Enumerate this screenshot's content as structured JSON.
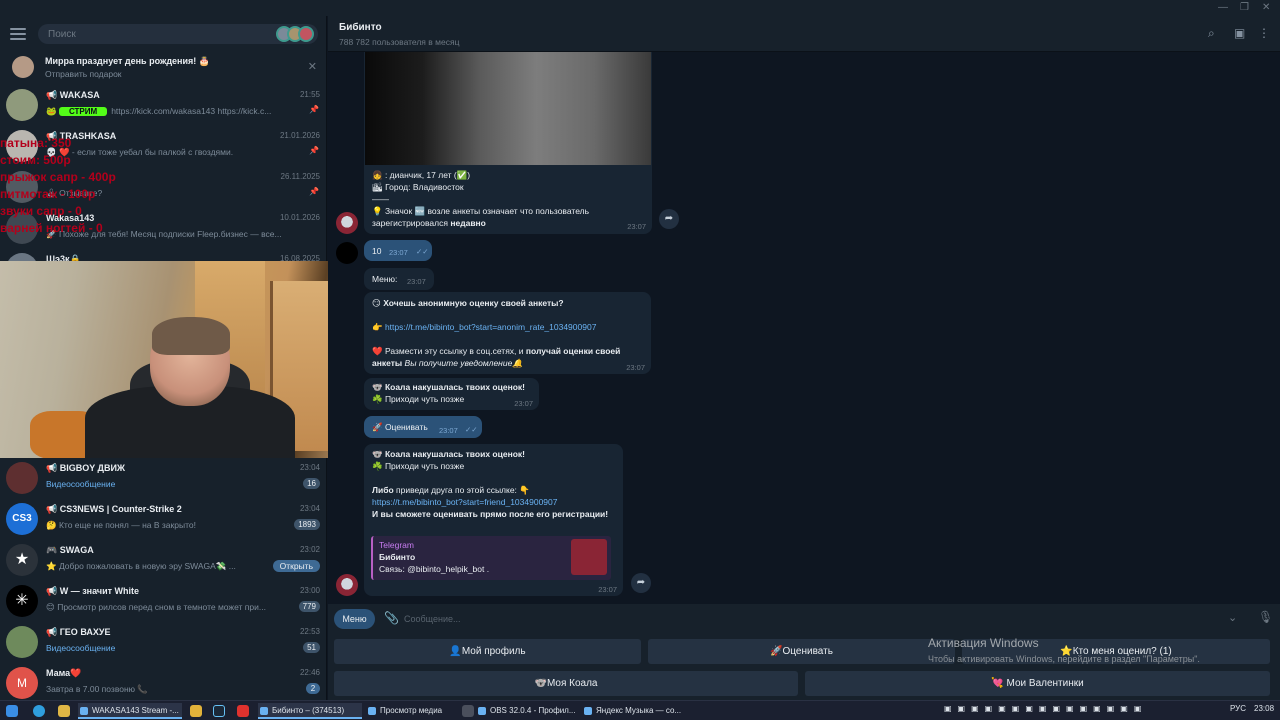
{
  "sidebar": {
    "search_placeholder": "Поиск",
    "birthday": {
      "title": "Мирра празднует день рождения! 🎂",
      "subtitle": "Отправить подарок"
    },
    "chats": [
      {
        "name": "📢 WAKASA",
        "time": "21:55",
        "prefix": "🐸",
        "tag": "СТРИМ",
        "preview": "https://kick.com/wakasa143  https://kick.c..."
      },
      {
        "name": "📢 TRASHKASA",
        "time": "21.01.2026",
        "preview": "💀 ❤️ - если тоже уебал бы палкой с гвоздями."
      },
      {
        "name": "",
        "time": "26.11.2025",
        "preview": "🕹 Отзывите?"
      },
      {
        "name": "Wakasa143",
        "time": "10.01.2026",
        "preview": "🚀 Похоже для тебя! Месяц подписки Fleep.бизнес — все..."
      },
      {
        "name": "Шэ3к🔒",
        "time": "16.08.2025",
        "preview": ""
      },
      {
        "name": "📢 BIGBOY ДВИЖ",
        "time": "23:04",
        "preview": "Видеосообщение",
        "badge": "16"
      },
      {
        "name": "📢 CS3NEWS | Counter-Strike 2",
        "time": "23:04",
        "preview": "🤔 Кто еще не понял — на В закрыто!",
        "badge": "1893"
      },
      {
        "name": "🎮 SWAGA",
        "time": "23:02",
        "preview": "⭐ Добро пожаловать в новую эру SWAGA💸 ...",
        "action": "Открыть"
      },
      {
        "name": "📢 W — значит White",
        "time": "23:00",
        "preview": "😊 Просмотр рилсов перед сном в темноте может при...",
        "badge": "779"
      },
      {
        "name": "📢 ГЕО ВАХУЕ",
        "time": "22:53",
        "preview": "Видеосообщение",
        "badge": "51"
      },
      {
        "name": "Мама❤️",
        "time": "22:46",
        "preview": "Завтра в 7.00 позвоню 📞",
        "badge": "2",
        "initial": "M"
      }
    ]
  },
  "overlay": {
    "lines": [
      "патына: 350",
      "стоим: 500р",
      "прыжок сапр - 400р",
      "питмотаж - 100р",
      "звуки сапр - 0",
      "варней ногтей - 0"
    ]
  },
  "header": {
    "title": "Бибинто",
    "subtitle": "788 782 пользователя в месяц"
  },
  "messages": {
    "profile": {
      "line1": "👧 : дианчик, 17 лет (✅)",
      "line2": "🏙 Город: Владивосток",
      "sep": "——",
      "note_pre": "💡 Значок 🆕 возле анкеты означает что пользователь",
      "note_post": "зарегистрировался",
      "note_bold": "недавно",
      "time": "23:07"
    },
    "out_10": {
      "text": "10",
      "time": "23:07"
    },
    "menu": {
      "text": "Меню:",
      "time": "23:07"
    },
    "rating": {
      "q": "😏 Хочешь анонимную оценку своей анкеты?",
      "link": "👉 https://t.me/bibinto_bot?start=anonim_rate_1034900907",
      "l1": "❤️ Размести эту ссылку в соц.сетях, и",
      "l1b": "получай оценки своей",
      "l2b": "анкеты",
      "l2i": "Вы получите уведомление🔔",
      "time": "23:07"
    },
    "koala1": {
      "l1": "🐨 Коала накушалась твоих оценок!",
      "l2": "☘️ Приходи чуть позже",
      "time": "23:07"
    },
    "out_rate": {
      "text": "🚀 Оценивать",
      "time": "23:07"
    },
    "koala2": {
      "l1": "🐨 Коала накушалась твоих оценок!",
      "l2": "☘️ Приходи чуть позже",
      "l3a": "Либо",
      "l3b": "приведи друга по этой ссылке: 👇",
      "link": "https://t.me/bibinto_bot?start=friend_1034900907",
      "l5": "И вы сможете оценивать прямо после его регистрации!",
      "quote_src": "Telegram",
      "quote_title": "Бибинто",
      "quote_text": "Связь: @bibinto_helpik_bot .",
      "time": "23:07"
    }
  },
  "input": {
    "menu_label": "Меню",
    "placeholder": "Сообщение..."
  },
  "keyboard": {
    "b1": "👤Мой профиль",
    "b2": "🚀Оценивать",
    "b3": "⭐Кто меня оценил? (1)",
    "b4": "🐨Моя Коала",
    "b5": "💘 Мои Валентинки"
  },
  "activation": {
    "title": "Активация Windows",
    "text": "Чтобы активировать Windows, перейдите в раздел \"Параметры\"."
  },
  "taskbar": {
    "items": [
      "WAKASA143 Stream -...",
      "Бибинто – (374513)",
      "Просмотр медиа",
      "OBS 32.0.4 - Профил...",
      "Яндекс Музыка — со..."
    ],
    "lang": "РУС",
    "time": "23:08"
  }
}
